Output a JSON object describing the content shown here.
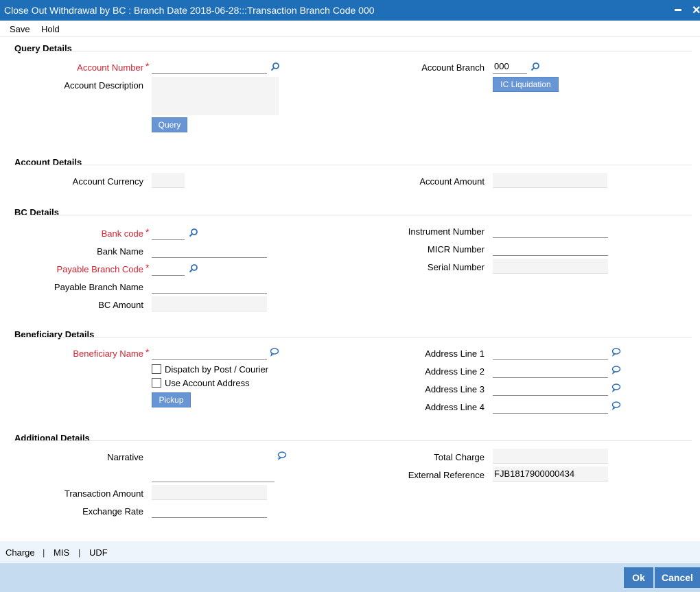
{
  "window": {
    "title": "Close Out Withdrawal by BC : Branch Date 2018-06-28:::Transaction Branch Code 000"
  },
  "menu": {
    "save": "Save",
    "hold": "Hold"
  },
  "query_details": {
    "section": "Query Details",
    "account_number_label": "Account Number",
    "account_number_value": "",
    "account_description_label": "Account Description",
    "account_branch_label": "Account Branch",
    "account_branch_value": "000",
    "ic_liquidation_button": "IC Liquidation",
    "query_button": "Query"
  },
  "account_details": {
    "section": "Account Details",
    "account_currency_label": "Account Currency",
    "account_amount_label": "Account Amount"
  },
  "bc_details": {
    "section": "BC Details",
    "bank_code_label": "Bank code",
    "bank_name_label": "Bank Name",
    "payable_branch_code_label": "Payable Branch Code",
    "payable_branch_name_label": "Payable Branch Name",
    "bc_amount_label": "BC Amount",
    "instrument_number_label": "Instrument Number",
    "micr_number_label": "MICR Number",
    "serial_number_label": "Serial Number"
  },
  "beneficiary_details": {
    "section": "Beneficiary Details",
    "beneficiary_name_label": "Beneficiary Name",
    "dispatch_label": "Dispatch by Post / Courier",
    "use_account_address_label": "Use Account Address",
    "pickup_button": "Pickup",
    "address_line_1_label": "Address Line 1",
    "address_line_2_label": "Address Line 2",
    "address_line_3_label": "Address Line 3",
    "address_line_4_label": "Address Line 4"
  },
  "additional_details": {
    "section": "Additional Details",
    "narrative_label": "Narrative",
    "transaction_amount_label": "Transaction Amount",
    "exchange_rate_label": "Exchange Rate",
    "total_charge_label": "Total Charge",
    "external_reference_label": "External Reference",
    "external_reference_value": "FJB1817900000434"
  },
  "bottom_tabs": {
    "charge": "Charge",
    "mis": "MIS",
    "udf": "UDF",
    "separator": "|"
  },
  "footer": {
    "ok": "Ok",
    "cancel": "Cancel"
  },
  "colors": {
    "title_bar": "#1f6fb8",
    "required_label": "#d4232f",
    "button": "#6896d4",
    "footer": "#c5dcf0",
    "footer_button": "#3e7cbf"
  },
  "icons": {
    "lookup": "search-icon",
    "text_edit": "speech-bubble-icon"
  }
}
